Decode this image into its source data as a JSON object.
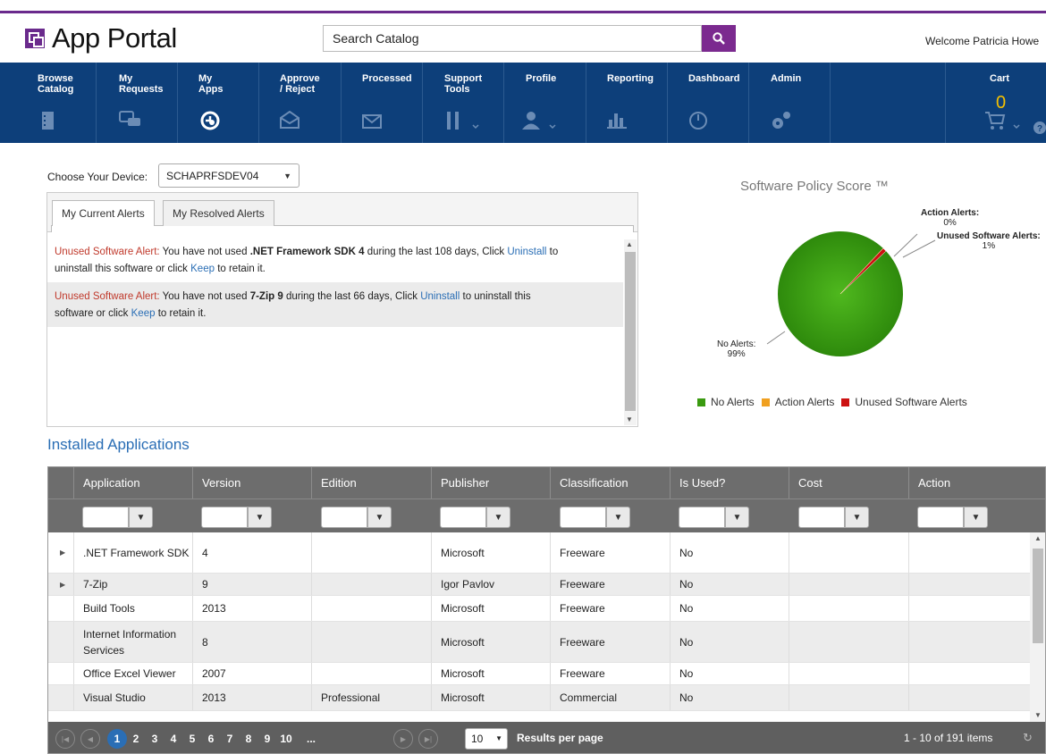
{
  "app": {
    "title": "App Portal",
    "search_placeholder": "Search Catalog",
    "welcome": "Welcome Patricia Howe",
    "brand_color": "#6a2a8c",
    "nav_color": "#0d3f7a"
  },
  "nav": {
    "items": [
      {
        "label1": "Browse",
        "label2": "Catalog",
        "icon": "book-icon"
      },
      {
        "label1": "My",
        "label2": "Requests",
        "icon": "chat-icon"
      },
      {
        "label1": "My",
        "label2": "Apps",
        "icon": "disc-icon"
      },
      {
        "label1": "Approve",
        "label2": "/ Reject",
        "icon": "envelope-open-icon"
      },
      {
        "label1": "Processed",
        "label2": "",
        "icon": "envelope-icon"
      },
      {
        "label1": "Support",
        "label2": "Tools",
        "icon": "tools-icon"
      },
      {
        "label1": "Profile",
        "label2": "",
        "icon": "user-icon"
      },
      {
        "label1": "Reporting",
        "label2": "",
        "icon": "bar-chart-icon"
      },
      {
        "label1": "Dashboard",
        "label2": "",
        "icon": "gauge-icon"
      },
      {
        "label1": "Admin",
        "label2": "",
        "icon": "gears-icon"
      },
      {
        "label1": "Cart",
        "label2": "",
        "icon": "cart-icon"
      }
    ],
    "cart_count": "0",
    "active": "My Apps"
  },
  "device": {
    "label": "Choose Your Device:",
    "selected": "SCHAPRFSDEV04"
  },
  "alerts": {
    "tabs": [
      "My Current Alerts",
      "My Resolved Alerts"
    ],
    "items": [
      {
        "prefix": "Unused Software Alert:",
        "text1": "You have not used",
        "app": ".NET Framework SDK 4",
        "text2": "during the last 108 days, Click",
        "uninstall": "Uninstall",
        "text3": "to",
        "text4": "uninstall this software or click",
        "keep": "Keep",
        "text5": "to retain it."
      },
      {
        "prefix": "Unused Software Alert:",
        "text1": "You have not used",
        "app": "7-Zip 9",
        "text2": "during the last 66 days, Click",
        "uninstall": "Uninstall",
        "text3": "to uninstall this",
        "text4": "software or click",
        "keep": "Keep",
        "text5": "to retain it."
      }
    ]
  },
  "policy": {
    "title": "Software Policy Score ™",
    "labels": {
      "action": "Action Alerts:",
      "action_pct": "0%",
      "unused": "Unused Software Alerts:",
      "unused_pct": "1%",
      "none": "No Alerts:",
      "none_pct": "99%"
    },
    "legend": [
      "No Alerts",
      "Action Alerts",
      "Unused Software Alerts"
    ],
    "colors": {
      "no_alerts": "#3a9a10",
      "action": "#f0a020",
      "unused": "#cc1111"
    }
  },
  "chart_data": {
    "type": "pie",
    "title": "Software Policy Score ™",
    "categories": [
      "No Alerts",
      "Action Alerts",
      "Unused Software Alerts"
    ],
    "values": [
      99,
      0,
      1
    ],
    "legend": "bottom"
  },
  "installed": {
    "title": "Installed Applications",
    "columns": [
      "Application",
      "Version",
      "Edition",
      "Publisher",
      "Classification",
      "Is Used?",
      "Cost",
      "Action"
    ],
    "rows": [
      {
        "expand": true,
        "app": ".NET Framework SDK",
        "version": "4",
        "edition": "",
        "publisher": "Microsoft",
        "class": "Freeware",
        "used": "No",
        "cost": "",
        "action": ""
      },
      {
        "expand": true,
        "app": "7-Zip",
        "version": "9",
        "edition": "",
        "publisher": "Igor Pavlov",
        "class": "Freeware",
        "used": "No",
        "cost": "",
        "action": ""
      },
      {
        "expand": false,
        "app": "Build Tools",
        "version": "2013",
        "edition": "",
        "publisher": "Microsoft",
        "class": "Freeware",
        "used": "No",
        "cost": "",
        "action": ""
      },
      {
        "expand": false,
        "app": "Internet Information Services",
        "version": "8",
        "edition": "",
        "publisher": "Microsoft",
        "class": "Freeware",
        "used": "No",
        "cost": "",
        "action": ""
      },
      {
        "expand": false,
        "app": "Office Excel Viewer",
        "version": "2007",
        "edition": "",
        "publisher": "Microsoft",
        "class": "Freeware",
        "used": "No",
        "cost": "",
        "action": ""
      },
      {
        "expand": false,
        "app": "Visual Studio",
        "version": "2013",
        "edition": "Professional",
        "publisher": "Microsoft",
        "class": "Commercial",
        "used": "No",
        "cost": "",
        "action": ""
      }
    ],
    "pager": {
      "pages": [
        "1",
        "2",
        "3",
        "4",
        "5",
        "6",
        "7",
        "8",
        "9",
        "10",
        "..."
      ],
      "current": "1",
      "page_size": "10",
      "results_per_page": "Results per page",
      "info": "1 - 10 of 191 items"
    }
  }
}
